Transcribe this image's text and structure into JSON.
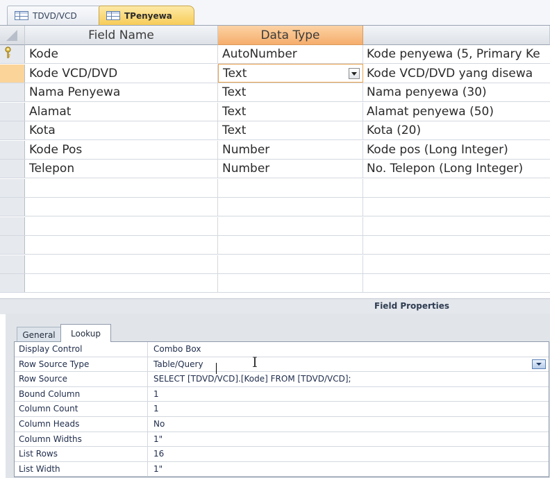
{
  "tabs": [
    {
      "label": "TDVD/VCD",
      "icon": "table-icon",
      "active": false
    },
    {
      "label": "TPenyewa",
      "icon": "table-icon",
      "active": true
    }
  ],
  "grid": {
    "headers": {
      "field_name": "Field Name",
      "data_type": "Data Type",
      "description": ""
    },
    "rows": [
      {
        "field": "Kode",
        "type": "AutoNumber",
        "desc": "Kode penyewa (5, Primary Ke",
        "primary_key": true
      },
      {
        "field": "Kode VCD/DVD",
        "type": "Text",
        "desc": "Kode VCD/DVD yang disewa",
        "active": true
      },
      {
        "field": "Nama Penyewa",
        "type": "Text",
        "desc": "Nama penyewa (30)"
      },
      {
        "field": "Alamat",
        "type": "Text",
        "desc": "Alamat penyewa (50)"
      },
      {
        "field": "Kota",
        "type": "Text",
        "desc": "Kota (20)"
      },
      {
        "field": "Kode Pos",
        "type": "Number",
        "desc": "Kode pos (Long Integer)"
      },
      {
        "field": "Telepon",
        "type": "Number",
        "desc": "No. Telepon (Long Integer)"
      },
      {
        "field": "",
        "type": "",
        "desc": ""
      },
      {
        "field": "",
        "type": "",
        "desc": ""
      },
      {
        "field": "",
        "type": "",
        "desc": ""
      },
      {
        "field": "",
        "type": "",
        "desc": ""
      },
      {
        "field": "",
        "type": "",
        "desc": ""
      },
      {
        "field": "",
        "type": "",
        "desc": ""
      }
    ]
  },
  "field_properties": {
    "title": "Field Properties",
    "tabs": {
      "general": "General",
      "lookup": "Lookup"
    },
    "rows": [
      {
        "label": "Display Control",
        "value": "Combo Box"
      },
      {
        "label": "Row Source Type",
        "value": "Table/Query",
        "has_dropdown": true
      },
      {
        "label": "Row Source",
        "value": "SELECT [TDVD/VCD].[Kode] FROM [TDVD/VCD];"
      },
      {
        "label": "Bound Column",
        "value": "1"
      },
      {
        "label": "Column Count",
        "value": "1"
      },
      {
        "label": "Column Heads",
        "value": "No"
      },
      {
        "label": "Column Widths",
        "value": "1\""
      },
      {
        "label": "List Rows",
        "value": "16"
      },
      {
        "label": "List Width",
        "value": "1\""
      }
    ]
  }
}
